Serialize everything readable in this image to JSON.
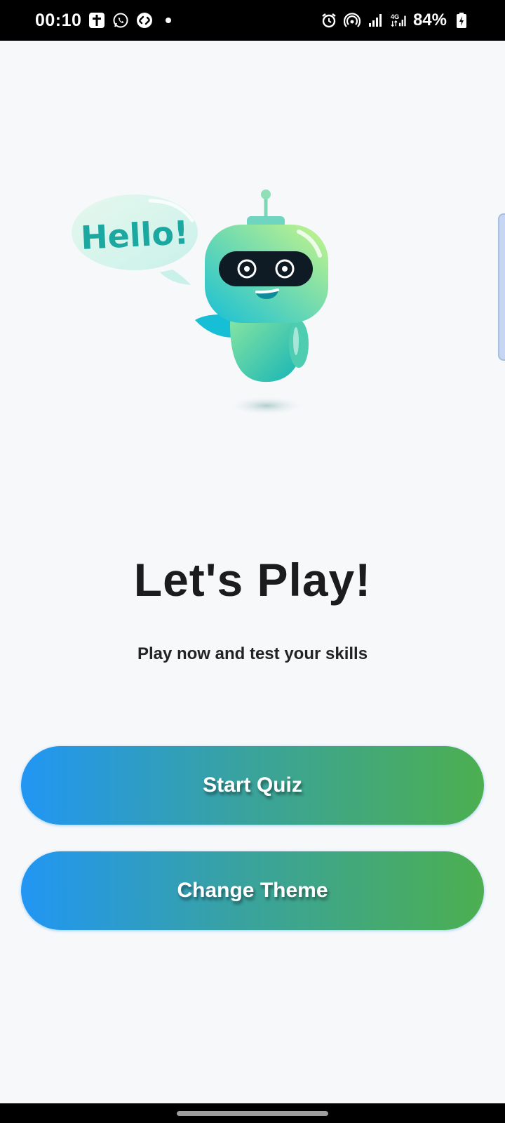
{
  "status_bar": {
    "time": "00:10",
    "battery": "84%",
    "left_icons": [
      "cross-app-icon",
      "whatsapp-icon",
      "shazam-icon",
      "notification-dot-icon"
    ],
    "right_icons": [
      "alarm-icon",
      "hotspot-icon",
      "signal-icon",
      "4g-signal-icon",
      "battery-charging-icon"
    ],
    "network_label": "4G"
  },
  "illustration": {
    "speech_bubble_text": "Hello!",
    "description_name": "robot-mascot"
  },
  "main": {
    "title": "Let's Play!",
    "subtitle": "Play now and test your skills"
  },
  "buttons": {
    "start_quiz": "Start Quiz",
    "change_theme": "Change Theme"
  },
  "colors": {
    "gradient_start": "#2196f3",
    "gradient_end": "#4caf50",
    "background": "#f7f8fa"
  }
}
